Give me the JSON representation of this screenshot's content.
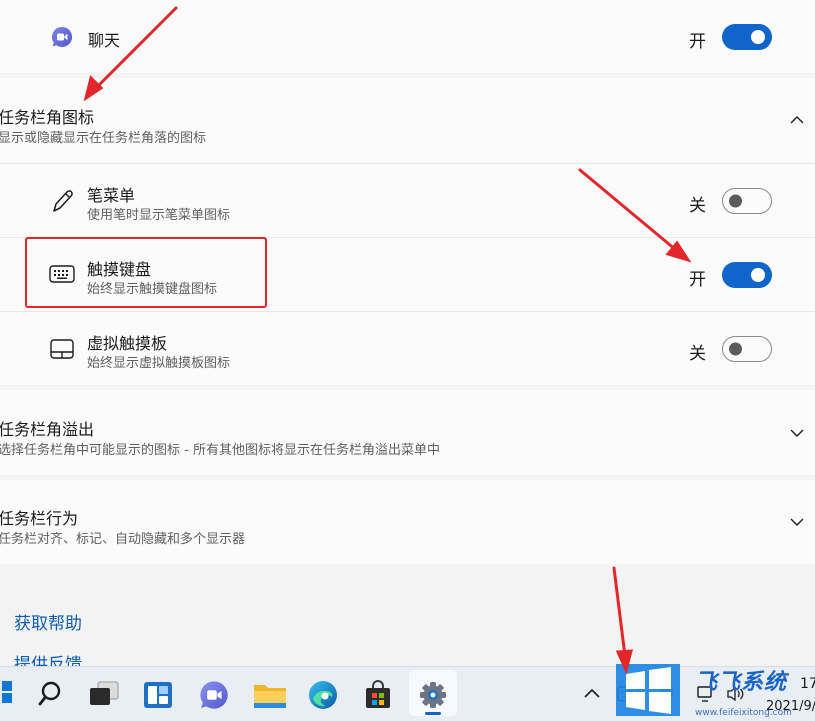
{
  "chat": {
    "label": "聊天",
    "state": "开",
    "on": true
  },
  "corner_icons": {
    "title": "任务栏角图标",
    "subtitle": "显示或隐藏显示在任务栏角落的图标",
    "items": [
      {
        "label": "笔菜单",
        "desc": "使用笔时显示笔菜单图标",
        "state": "关",
        "on": false
      },
      {
        "label": "触摸键盘",
        "desc": "始终显示触摸键盘图标",
        "state": "开",
        "on": true
      },
      {
        "label": "虚拟触摸板",
        "desc": "始终显示虚拟触摸板图标",
        "state": "关",
        "on": false
      }
    ]
  },
  "overflow": {
    "title": "任务栏角溢出",
    "subtitle": "选择任务栏角中可能显示的图标 - 所有其他图标将显示在任务栏角溢出菜单中"
  },
  "behavior": {
    "title": "任务栏行为",
    "subtitle": "任务栏对齐、标记、自动隐藏和多个显示器"
  },
  "links": {
    "help": "获取帮助",
    "feedback": "提供反馈"
  },
  "taskbar": {
    "icons": [
      "start-icon",
      "search-icon",
      "task-view-icon",
      "widgets-icon",
      "chat-icon",
      "file-explorer-icon",
      "edge-icon",
      "store-icon",
      "settings-icon"
    ],
    "ime": "中",
    "time": "17",
    "date": "2021/9/"
  },
  "watermark": {
    "brand": "飞飞系统",
    "url": "www.feifeixitong.com"
  },
  "colors": {
    "accent": "#0f65c9",
    "annotation": "#e2262a",
    "link": "#0b5cb8"
  }
}
